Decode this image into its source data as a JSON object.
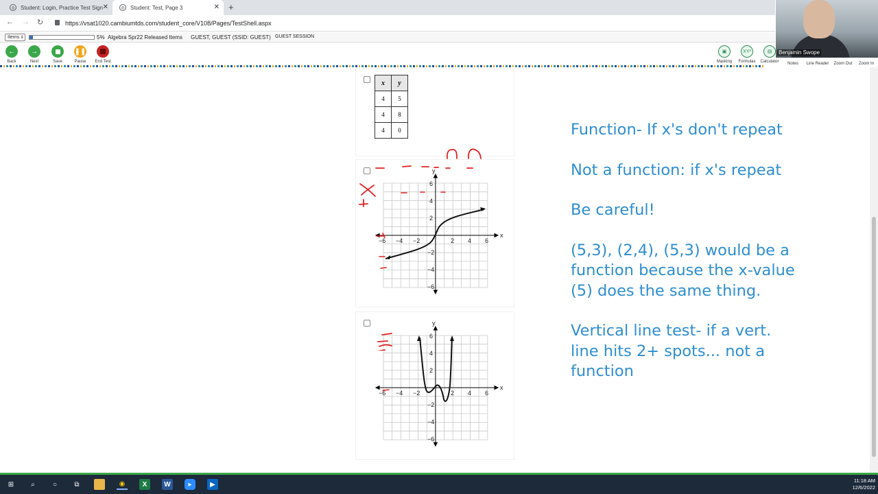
{
  "browser": {
    "tabs": [
      {
        "title": "Student: Login, Practice Test Sign",
        "close": "✕"
      },
      {
        "title": "Student: Test, Page 3",
        "close": "✕"
      }
    ],
    "new_tab": "+",
    "url": "https://vsat1020.cambiumtds.com/student_core/V108/Pages/TestShell.aspx"
  },
  "infobar": {
    "items_label": "Items",
    "progress_percent": 5,
    "progress_text": "5%",
    "test_name": "Algebra Spr22 Released Items",
    "student": "GUEST, GUEST (SSID: GUEST)",
    "session": "GUEST SESSION"
  },
  "toolbar": {
    "left": [
      {
        "label": "Back",
        "icon": "arrow-left-icon"
      },
      {
        "label": "Next",
        "icon": "arrow-right-icon"
      },
      {
        "label": "Save",
        "icon": "save-icon"
      },
      {
        "label": "Pause",
        "icon": "pause-icon"
      },
      {
        "label": "End Test",
        "icon": "stop-icon"
      }
    ],
    "right": [
      {
        "label": "Masking",
        "glyph": "▣"
      },
      {
        "label": "Formulas",
        "glyph": "XY²"
      },
      {
        "label": "Calculator",
        "glyph": ""
      },
      {
        "label": "Notes",
        "glyph": ""
      },
      {
        "label": "Line Reader",
        "glyph": ""
      },
      {
        "label": "Zoom Out",
        "glyph": ""
      },
      {
        "label": "Zoom In",
        "glyph": ""
      }
    ]
  },
  "webcam": {
    "name": "Benjamin Swope"
  },
  "question": {
    "table": {
      "headers": [
        "x",
        "y"
      ],
      "rows": [
        [
          "4",
          "5"
        ],
        [
          "4",
          "8"
        ],
        [
          "4",
          "0"
        ]
      ]
    },
    "graph_labels": {
      "x": "x",
      "y": "y",
      "ticks_x": [
        "−6",
        "−4",
        "−2",
        "2",
        "4",
        "6"
      ],
      "ticks_y": [
        "6",
        "4",
        "2",
        "−2",
        "−4",
        "−6"
      ]
    }
  },
  "notes": [
    "Function- If x's don't repeat",
    "Not a function: if x's repeat",
    "Be careful!",
    "(5,3), (2,4), (5,3) would be a function because the x-value (5) does the same thing.",
    "Vertical line test- if a vert. line hits 2+ spots... not a function"
  ],
  "taskbar": {
    "time": "11:18 AM",
    "date": "12/6/2022"
  },
  "colors": {
    "notes": "#2e8ecf",
    "annotation": "#e02020",
    "accent_green": "#3aa84a",
    "progress": "#3a6db5"
  }
}
